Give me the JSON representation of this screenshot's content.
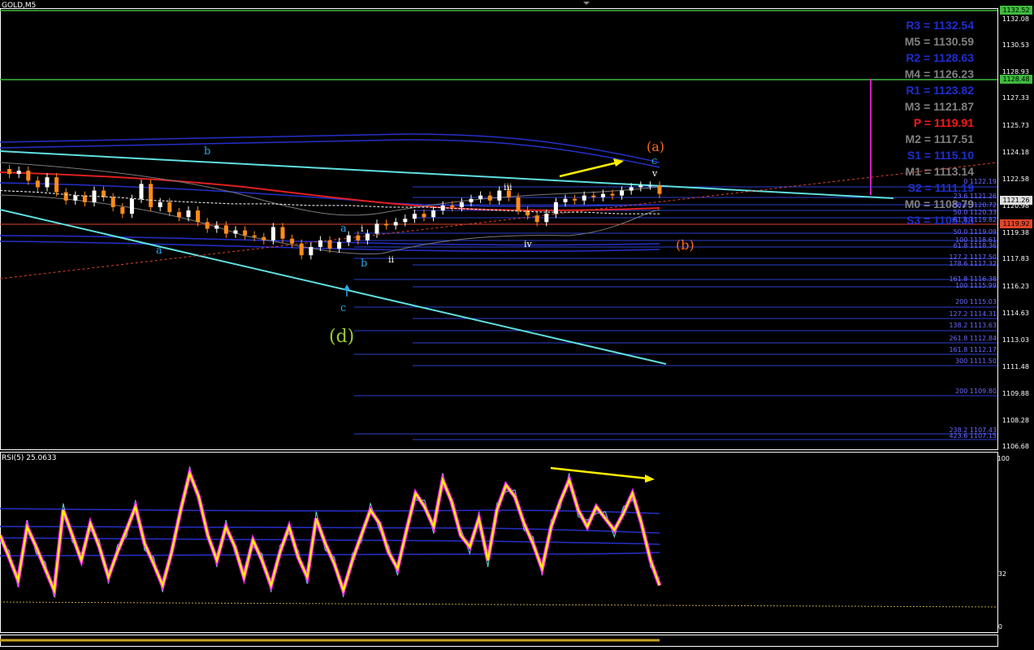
{
  "window": {
    "symbol_title": "GOLD,M5",
    "rsi_title": "RSI(5) 25.0633"
  },
  "price_axis": {
    "ticks": [
      "1132.08",
      "1130.53",
      "1128.93",
      "1127.33",
      "1125.73",
      "1124.18",
      "1122.58",
      "1120.98",
      "1119.38",
      "1117.83",
      "1116.23",
      "1114.63",
      "1113.03",
      "1111.48",
      "1109.88",
      "1108.28",
      "1106.68"
    ]
  },
  "price_badges": [
    {
      "text": "1132.52",
      "color": "#3dbb3d"
    },
    {
      "text": "1128.48",
      "color": "#3dbb3d"
    },
    {
      "text": "1121.26",
      "color": "#dddddd"
    },
    {
      "text": "1119.92",
      "color": "#e0452a"
    }
  ],
  "pivots": [
    {
      "text": "R3 = 1132.54",
      "color": "#1e2fcf"
    },
    {
      "text": "M5 = 1130.59",
      "color": "#808080"
    },
    {
      "text": "R2 = 1128.63",
      "color": "#1e2fcf"
    },
    {
      "text": "M4 = 1126.23",
      "color": "#808080"
    },
    {
      "text": "R1 = 1123.82",
      "color": "#1e2fcf"
    },
    {
      "text": "M3 = 1121.87",
      "color": "#808080"
    },
    {
      "text": "P   = 1119.91",
      "color": "#ff1a1a"
    },
    {
      "text": "M2 = 1117.51",
      "color": "#808080"
    },
    {
      "text": "S1 = 1115.10",
      "color": "#1e2fcf"
    },
    {
      "text": "M1 = 1113.14",
      "color": "#808080"
    },
    {
      "text": "S2 = 1111.19",
      "color": "#1e2fcf"
    },
    {
      "text": "M0 = 1108.79",
      "color": "#808080"
    },
    {
      "text": "S3 = 1106.38",
      "color": "#1e2fcf"
    }
  ],
  "fib_levels": [
    {
      "text": "0 1122.19",
      "color": "#6a6aff"
    },
    {
      "text": "23.6 1121.26",
      "color": "#6a6aff"
    },
    {
      "text": "38.2 1120.72",
      "color": "#6a6aff"
    },
    {
      "text": "50.0 1120.33",
      "color": "#6a6aff"
    },
    {
      "text": "61.8 1119.82",
      "color": "#6a6aff"
    },
    {
      "text": "50.0 1119.09",
      "color": "#6a6aff"
    },
    {
      "text": "100 1118.61",
      "color": "#6a6aff"
    },
    {
      "text": "61.8 1118.36",
      "color": "#6a6aff"
    },
    {
      "text": "127.2 1117.50",
      "color": "#6a6aff"
    },
    {
      "text": "178.6 1117.32",
      "color": "#6a6aff"
    },
    {
      "text": "161.8 1116.38",
      "color": "#6a6aff"
    },
    {
      "text": "100 1115.99",
      "color": "#6a6aff"
    },
    {
      "text": "200 1115.03",
      "color": "#6a6aff"
    },
    {
      "text": "127.2 1114.31",
      "color": "#6a6aff"
    },
    {
      "text": "138.2 1113.63",
      "color": "#6a6aff"
    },
    {
      "text": "261.8 1112.84",
      "color": "#6a6aff"
    },
    {
      "text": "161.8 1112.17",
      "color": "#6a6aff"
    },
    {
      "text": "300 1111.50",
      "color": "#6a6aff"
    },
    {
      "text": "200 1109.80",
      "color": "#6a6aff"
    },
    {
      "text": "238.2 1107.43",
      "color": "#6a6aff"
    },
    {
      "text": "423.6 1107.15",
      "color": "#6a6aff"
    }
  ],
  "wave_labels": [
    {
      "text": "b",
      "color": "#2aa7e6"
    },
    {
      "text": "a",
      "color": "#2aa7e6"
    },
    {
      "text": "a",
      "color": "#2aa7e6"
    },
    {
      "text": "b",
      "color": "#2aa7e6"
    },
    {
      "text": "c",
      "color": "#2aa7e6"
    },
    {
      "text": "(d)",
      "color": "#9acd32"
    },
    {
      "text": "i",
      "color": "#ffffff"
    },
    {
      "text": "ii",
      "color": "#ffffff"
    },
    {
      "text": "iii",
      "color": "#ffffff"
    },
    {
      "text": "iv",
      "color": "#ffffff"
    },
    {
      "text": "v",
      "color": "#ffffff"
    },
    {
      "text": "c",
      "color": "#2aa7e6"
    },
    {
      "text": "(a)",
      "color": "#ff6a1a"
    },
    {
      "text": "(b)",
      "color": "#ff6a1a"
    }
  ],
  "rsi_axis": {
    "ticks": [
      "100",
      "32",
      "0"
    ]
  },
  "chart_data": [
    {
      "type": "line",
      "title": "GOLD,M5",
      "ylim": [
        1106.0,
        1132.6
      ],
      "horizontal_lines": [
        1132.52,
        1128.48,
        1119.92
      ],
      "series": [
        {
          "values": [
            1122.9,
            1122.6,
            1122.8,
            1122.2,
            1121.8,
            1122.4,
            1121.5,
            1121.0,
            1121.3,
            1120.9,
            1121.6,
            1121.2,
            1120.6,
            1120.2,
            1121.1,
            1122.0,
            1120.6,
            1120.9,
            1120.3,
            1120.0,
            1120.4,
            1119.7,
            1119.3,
            1119.5,
            1119.0,
            1119.2,
            1118.9,
            1118.8,
            1118.6,
            1119.4,
            1118.7,
            1118.4,
            1117.7,
            1118.2,
            1118.6,
            1118.1,
            1118.5,
            1118.9,
            1118.6,
            1119.0,
            1119.6,
            1119.5,
            1119.7,
            1119.9,
            1120.2,
            1120.0,
            1120.4,
            1120.7,
            1120.6,
            1120.9,
            1121.1,
            1121.3,
            1121.0,
            1121.6,
            1121.2,
            1120.4,
            1120.1,
            1119.7,
            1120.2,
            1120.9,
            1121.1,
            1121.0,
            1121.3,
            1121.2,
            1121.4,
            1121.3,
            1121.6,
            1121.8,
            1121.9,
            1121.9,
            1121.4
          ]
        },
        {
          "values": [
            1121.6,
            1121.5,
            1121.3,
            1121.2,
            1121.0,
            1120.9,
            1120.8,
            1120.8,
            1120.7,
            1120.7,
            1120.6,
            1120.6,
            1120.5,
            1120.4,
            1120.3,
            1120.3,
            1120.2,
            1120.2
          ]
        }
      ]
    },
    {
      "type": "line",
      "title": "RSI(5) 25.0633",
      "ylim": [
        0,
        100
      ],
      "series": [
        {
          "values": [
            55,
            42,
            28,
            60,
            48,
            35,
            22,
            70,
            55,
            40,
            62,
            48,
            30,
            45,
            58,
            72,
            50,
            38,
            25,
            45,
            70,
            92,
            78,
            55,
            40,
            60,
            48,
            30,
            52,
            40,
            25,
            45,
            60,
            42,
            30,
            65,
            50,
            38,
            22,
            40,
            55,
            70,
            62,
            45,
            35,
            58,
            80,
            72,
            60,
            88,
            75,
            55,
            48,
            65,
            40,
            70,
            85,
            78,
            62,
            50,
            35,
            60,
            75,
            88,
            70,
            60,
            72,
            65,
            58,
            68,
            80,
            62,
            40,
            25
          ]
        }
      ]
    }
  ]
}
